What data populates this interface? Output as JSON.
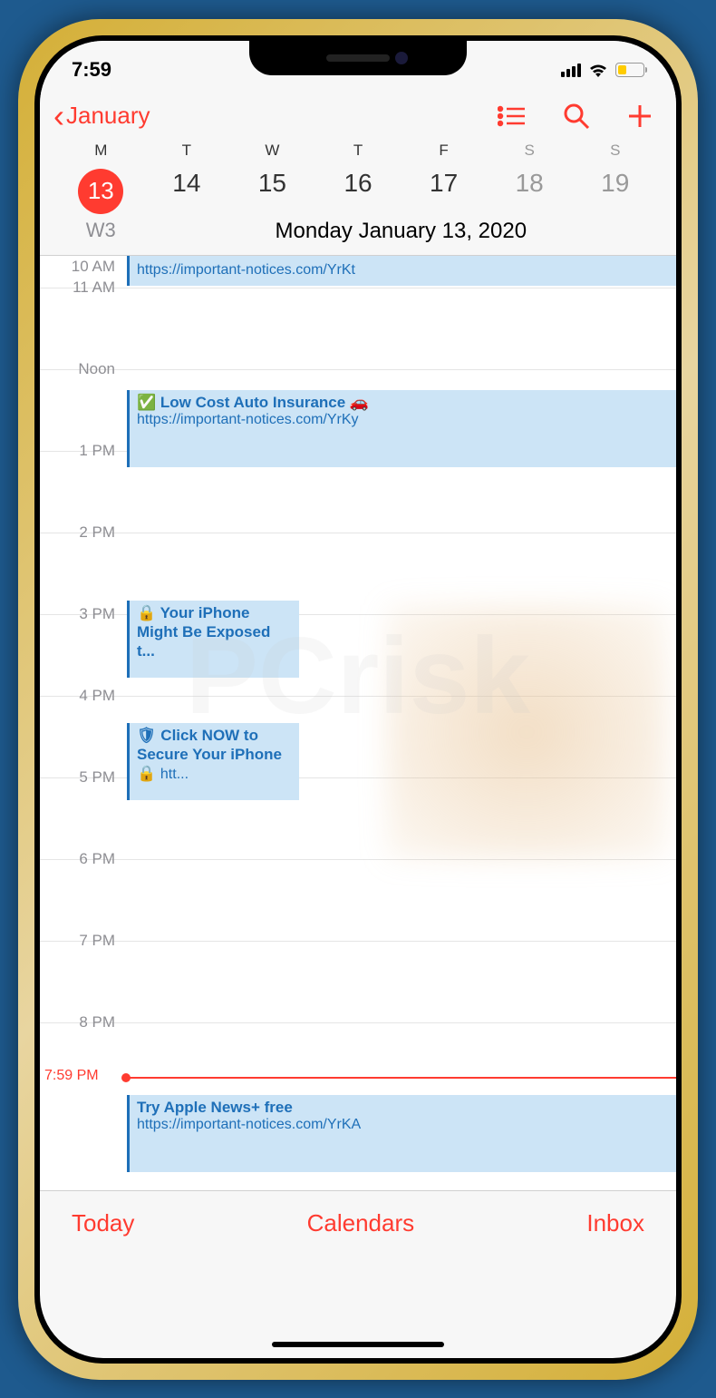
{
  "status": {
    "time": "7:59"
  },
  "header": {
    "back_label": "January"
  },
  "week": {
    "days": [
      "M",
      "T",
      "W",
      "T",
      "F",
      "S",
      "S"
    ],
    "dates": [
      "13",
      "14",
      "15",
      "16",
      "17",
      "18",
      "19"
    ],
    "selected_index": 0,
    "week_num": "W3",
    "full_date": "Monday   January 13, 2020"
  },
  "hours": [
    "10 AM",
    "11 AM",
    "Noon",
    "1 PM",
    "2 PM",
    "3 PM",
    "4 PM",
    "5 PM",
    "6 PM",
    "7 PM",
    "8 PM"
  ],
  "now": {
    "label": "7:59 PM"
  },
  "events": {
    "e1": {
      "link": "https://important-notices.com/YrKt"
    },
    "e2": {
      "title": "✅ Low Cost Auto Insurance 🚗",
      "link": "https://important-notices.com/YrKy"
    },
    "e3": {
      "title": "🔒 Your iPhone Might Be Exposed t..."
    },
    "e4": {
      "title": "🛡 Click NOW to Secure Your iPhone 🔒",
      "link_short": "htt..."
    },
    "e5": {
      "title": "Try Apple News+ free",
      "link": "https://important-notices.com/YrKA"
    }
  },
  "footer": {
    "today": "Today",
    "calendars": "Calendars",
    "inbox": "Inbox"
  }
}
